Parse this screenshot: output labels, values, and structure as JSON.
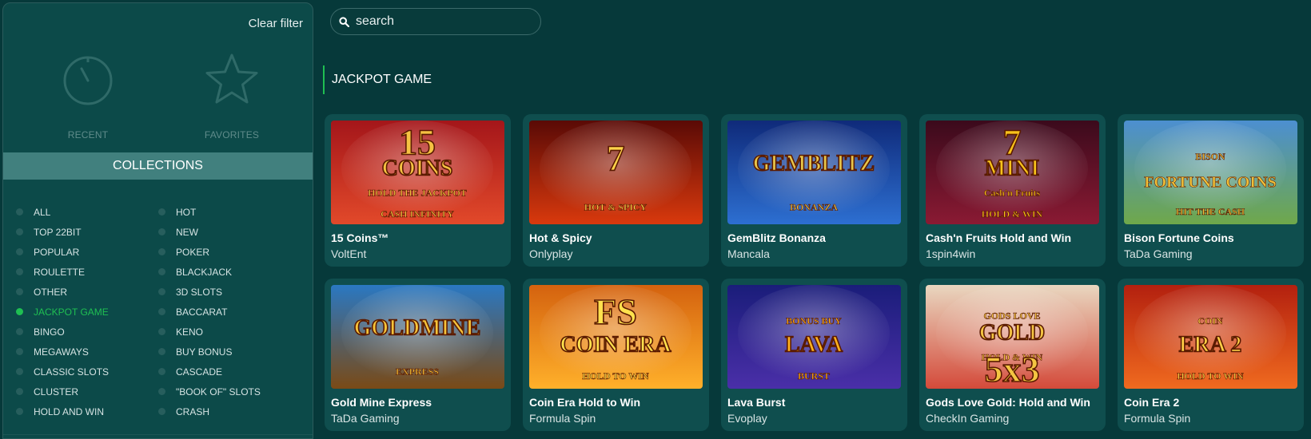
{
  "sidebar": {
    "clear_filter": "Clear filter",
    "recent_label": "RECENT",
    "favorites_label": "FAVORITES",
    "collections_title": "COLLECTIONS",
    "categories": [
      {
        "label": "ALL",
        "active": false
      },
      {
        "label": "HOT",
        "active": false
      },
      {
        "label": "TOP 22BIT",
        "active": false
      },
      {
        "label": "NEW",
        "active": false
      },
      {
        "label": "POPULAR",
        "active": false
      },
      {
        "label": "POKER",
        "active": false
      },
      {
        "label": "ROULETTE",
        "active": false
      },
      {
        "label": "BLACKJACK",
        "active": false
      },
      {
        "label": "OTHER",
        "active": false
      },
      {
        "label": "3D SLOTS",
        "active": false
      },
      {
        "label": "JACKPOT GAME",
        "active": true
      },
      {
        "label": "BACCARAT",
        "active": false
      },
      {
        "label": "BINGO",
        "active": false
      },
      {
        "label": "KENO",
        "active": false
      },
      {
        "label": "MEGAWAYS",
        "active": false
      },
      {
        "label": "BUY BONUS",
        "active": false
      },
      {
        "label": "CLASSIC SLOTS",
        "active": false
      },
      {
        "label": "CASCADE",
        "active": false
      },
      {
        "label": "CLUSTER",
        "active": false
      },
      {
        "label": "\"BOOK OF\" SLOTS",
        "active": false
      },
      {
        "label": "HOLD AND WIN",
        "active": false
      },
      {
        "label": "CRASH",
        "active": false
      }
    ]
  },
  "search": {
    "placeholder": "search",
    "icon": "search-icon"
  },
  "section": {
    "title": "JACKPOT GAME"
  },
  "colors": {
    "accent": "#1fbf52",
    "background": "#06393a",
    "sidebar": "#0c4a49",
    "card": "#0f4e4e"
  },
  "games": [
    {
      "name": "15 Coins™",
      "provider": "VoltEnt",
      "art": [
        "15",
        "COINS",
        "HOLD THE JACKPOT",
        "CASH INFINITY"
      ],
      "bg1": "#a4161a",
      "bg2": "#e2492a",
      "fg": "#f5c242"
    },
    {
      "name": "Hot & Spicy",
      "provider": "Onlyplay",
      "art": [
        "7",
        "HOT & SPICY"
      ],
      "bg1": "#5a0a06",
      "bg2": "#d9390d",
      "fg": "#ffd34a"
    },
    {
      "name": "GemBlitz Bonanza",
      "provider": "Mancala",
      "art": [
        "GEMBLITZ",
        "BONANZA"
      ],
      "bg1": "#0f2a7a",
      "bg2": "#2d6fd1",
      "fg": "#e8c64a"
    },
    {
      "name": "Cash'n Fruits Hold and Win",
      "provider": "1spin4win",
      "art": [
        "7",
        "MINI",
        "Cash'n Fruits",
        "HOLD & WIN"
      ],
      "bg1": "#3b0a1c",
      "bg2": "#8a1a33",
      "fg": "#f7c21b"
    },
    {
      "name": "Bison Fortune Coins",
      "provider": "TaDa Gaming",
      "art": [
        "BISON",
        "FORTUNE COINS",
        "HIT THE CASH"
      ],
      "bg1": "#4c8fd1",
      "bg2": "#6fa84a",
      "fg": "#f3c33a"
    },
    {
      "name": "Gold Mine Express",
      "provider": "TaDa Gaming",
      "art": [
        "GOLDMINE",
        "EXPRESS"
      ],
      "bg1": "#2a78c2",
      "bg2": "#7a4a16",
      "fg": "#f6c43a"
    },
    {
      "name": "Coin Era Hold to Win",
      "provider": "Formula Spin",
      "art": [
        "FS",
        "COIN ERA",
        "HOLD TO WIN"
      ],
      "bg1": "#d4620f",
      "bg2": "#ffb02a",
      "fg": "#ffe14d"
    },
    {
      "name": "Lava Burst",
      "provider": "Evoplay",
      "art": [
        "BONUS BUY",
        "LAVA",
        "BURST"
      ],
      "bg1": "#1a1d7a",
      "bg2": "#4a2fa8",
      "fg": "#ffb21e"
    },
    {
      "name": "Gods Love Gold: Hold and Win",
      "provider": "CheckIn Gaming",
      "art": [
        "GODS LOVE",
        "GOLD",
        "HOLD & WIN",
        "5x3"
      ],
      "bg1": "#e9d7c0",
      "bg2": "#d44a3a",
      "fg": "#f4c542"
    },
    {
      "name": "Coin Era 2",
      "provider": "Formula Spin",
      "art": [
        "COIN",
        "ERA 2",
        "HOLD TO WIN"
      ],
      "bg1": "#b3200f",
      "bg2": "#f06a1f",
      "fg": "#ffd046"
    }
  ]
}
